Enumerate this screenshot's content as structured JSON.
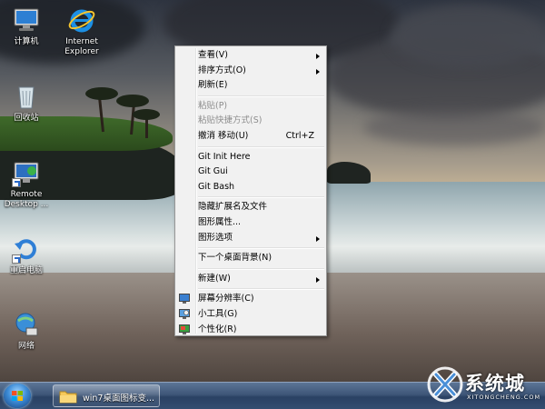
{
  "desktop": {
    "icons": [
      {
        "label_line1": "计算机",
        "label_line2": ""
      },
      {
        "label_line1": "Internet",
        "label_line2": "Explorer"
      },
      {
        "label_line1": "回收站",
        "label_line2": ""
      },
      {
        "label_line1": "Remote",
        "label_line2": "Desktop ..."
      },
      {
        "label_line1": "重启电脑",
        "label_line2": ""
      },
      {
        "label_line1": "网络",
        "label_line2": ""
      }
    ]
  },
  "context_menu": {
    "items": [
      {
        "label": "查看(V)",
        "submenu": true,
        "icon": ""
      },
      {
        "label": "排序方式(O)",
        "submenu": true,
        "icon": ""
      },
      {
        "label": "刷新(E)",
        "submenu": false,
        "icon": ""
      },
      {
        "label": "粘贴(P)",
        "submenu": false,
        "disabled": true
      },
      {
        "label": "粘贴快捷方式(S)",
        "submenu": false,
        "disabled": true
      },
      {
        "label": "撤消 移动(U)",
        "shortcut": "Ctrl+Z"
      },
      {
        "label": "Git Init Here"
      },
      {
        "label": "Git Gui"
      },
      {
        "label": "Git Bash"
      },
      {
        "label": "隐藏扩展名及文件"
      },
      {
        "label": "图形属性..."
      },
      {
        "label": "图形选项",
        "submenu": true
      },
      {
        "label": "下一个桌面背景(N)"
      },
      {
        "label": "新建(W)",
        "submenu": true
      },
      {
        "label": "屏幕分辨率(C)",
        "icon": "display-icon"
      },
      {
        "label": "小工具(G)",
        "icon": "gadgets-icon"
      },
      {
        "label": "个性化(R)",
        "icon": "personalize-icon"
      }
    ]
  },
  "taskbar": {
    "window_button_label": "win7桌面图标变..."
  },
  "watermark": {
    "brand": "系统城",
    "url": "XITONGCHENG.COM"
  },
  "colors": {
    "menu_bg": "#f1f1f1",
    "taskbar_top": "#5c7596",
    "taskbar_bottom": "#2a4163"
  }
}
